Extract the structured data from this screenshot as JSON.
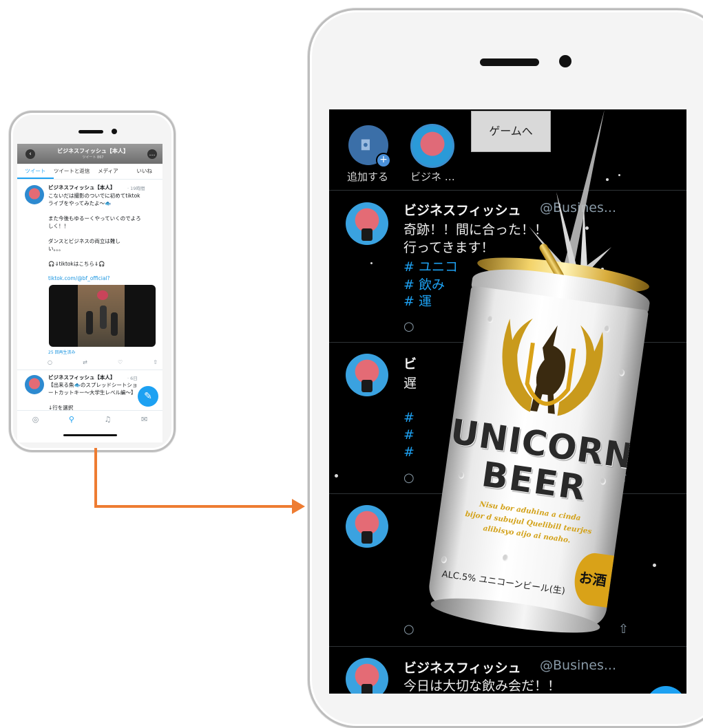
{
  "small_phone": {
    "header_title": "ビジネスフィッシュ【本人】",
    "header_sub": "ツイート 867",
    "tabs": [
      "ツイート",
      "ツイートと返信",
      "メディア",
      "いいね"
    ],
    "tweet1": {
      "name": "ビジネスフィッシュ【本人】",
      "time": "· 19時間",
      "lines": "こないだは撮影のついでに初めてtiktok\nライブをやってみたよ〜🐟\n\nまた今後もゆるーくやっていくのでよろ\nしく！！\n\nダンスとビジネスの両立は難し\nい。。。\n\n🎧⇓tiktokはこちら⇓🎧",
      "link": "tiktok.com/@bf_official?",
      "views": "25 回再生済み"
    },
    "tweet2": {
      "name": "ビジネスフィッシュ【本人】",
      "time": "· 6日",
      "lines": "【出来る魚🐟のスプレッドシートショ\nートカットキー〜大学生レベル編〜】\n\n↓行を選択"
    }
  },
  "large_phone": {
    "fleets": [
      {
        "label": "追加する"
      },
      {
        "label": "ビジネ …"
      }
    ],
    "game_button": "ゲームへ",
    "tweets": [
      {
        "name": "ビジネスフィッシュ",
        "handle": "@Busines...",
        "lines": [
          "奇跡！！間に合った！！",
          "行ってきます！"
        ],
        "tags": [
          "# ユニコ",
          "# 飲み",
          "# 運"
        ]
      },
      {
        "name": "ビ",
        "handle": "",
        "lines": [
          "遅"
        ],
        "tags": [
          "#",
          "#",
          "#"
        ]
      },
      {
        "name": "",
        "handle": "",
        "lines": [],
        "tags": []
      },
      {
        "name": "ビジネスフィッシュ",
        "handle": "@Busines...",
        "lines": [
          "今日は大切な飲み会だ！！"
        ],
        "tags": []
      }
    ]
  },
  "beer_can": {
    "brand_line1": "UNICORN",
    "brand_line2": "BEER",
    "tagline": "Nisu bor aduhina a cinda\nbijor d subujul Quelibill teurjes\nalibisyo aijo ai noaho.",
    "alc_text": "ALC.5% ユニコーンビール(生)",
    "badge": "お酒"
  },
  "colors": {
    "arrow": "#ee7c32",
    "twitter_blue": "#1da1f2",
    "gold": "#d9a218"
  }
}
